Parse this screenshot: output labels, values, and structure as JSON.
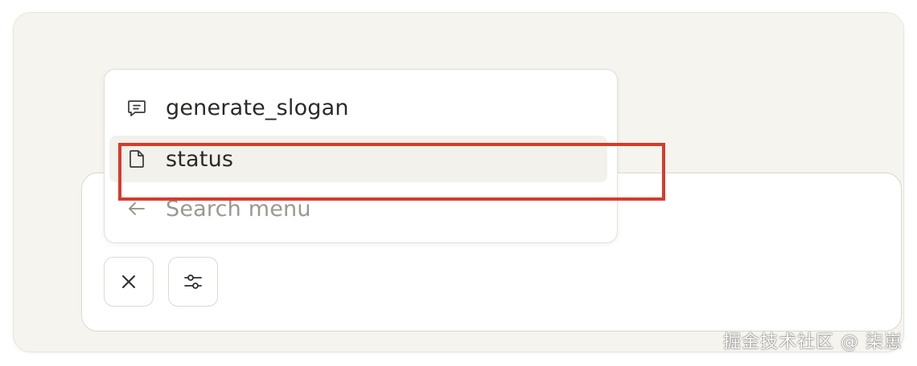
{
  "menu": {
    "items": [
      {
        "label": "generate_slogan",
        "icon": "message-square-icon"
      },
      {
        "label": "status",
        "icon": "file-icon"
      }
    ],
    "search_placeholder": "Search menu",
    "back_icon": "arrow-left-icon"
  },
  "toolbar": {
    "close_icon": "close-icon",
    "tools_icon": "sliders-icon"
  },
  "annotation": {
    "highlight_color": "#d93a2b"
  },
  "watermark": "掘金技术社区 @ 柒崽"
}
